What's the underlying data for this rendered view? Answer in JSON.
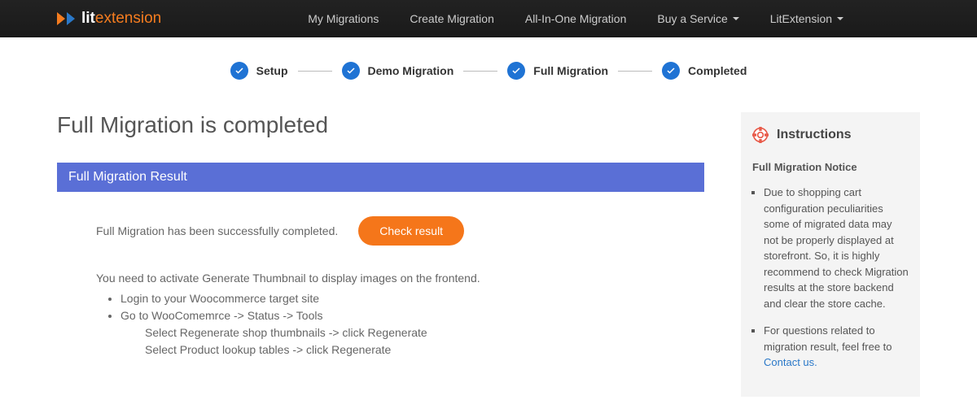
{
  "logo": {
    "bold": "lit",
    "rest": "extension"
  },
  "nav": {
    "my_migrations": "My Migrations",
    "create_migration": "Create Migration",
    "all_in_one": "All-In-One Migration",
    "buy_service": "Buy a Service",
    "litextension": "LitExtension"
  },
  "steps": {
    "setup": "Setup",
    "demo": "Demo Migration",
    "full": "Full Migration",
    "completed": "Completed"
  },
  "page": {
    "title": "Full Migration is completed",
    "result_header": "Full Migration Result",
    "success_msg": "Full Migration has been successfully completed.",
    "check_btn": "Check result",
    "activate_note": "You need to activate Generate Thumbnail to display images on the frontend.",
    "bullets": {
      "b1": "Login to your Woocommerce target site",
      "b2": "Go to WooComemrce -> Status -> Tools",
      "b2a": "Select Regenerate shop thumbnails -> click Regenerate",
      "b2b": "Select Product lookup tables -> click Regenerate"
    }
  },
  "side": {
    "heading": "Instructions",
    "subheading": "Full Migration Notice",
    "note1": "Due to shopping cart configuration peculiarities some of migrated data may not be properly displayed at storefront. So, it is highly recommend to check Migration results at the store backend and clear the store cache.",
    "note2_pre": "For questions related to migration result, feel free to ",
    "contact": "Contact us."
  }
}
